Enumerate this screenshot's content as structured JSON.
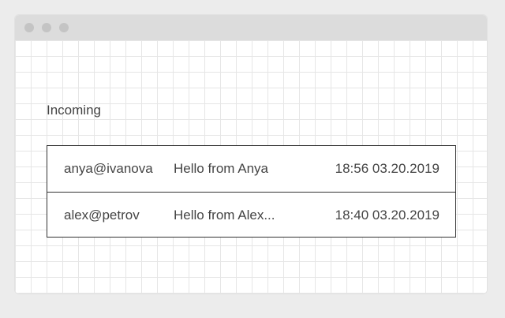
{
  "inbox": {
    "heading": "Incoming",
    "messages": [
      {
        "from": "anya@ivanova",
        "subject": "Hello from Anya",
        "time": "18:56 03.20.2019"
      },
      {
        "from": "alex@petrov",
        "subject": "Hello from Alex...",
        "time": "18:40 03.20.2019"
      }
    ]
  }
}
